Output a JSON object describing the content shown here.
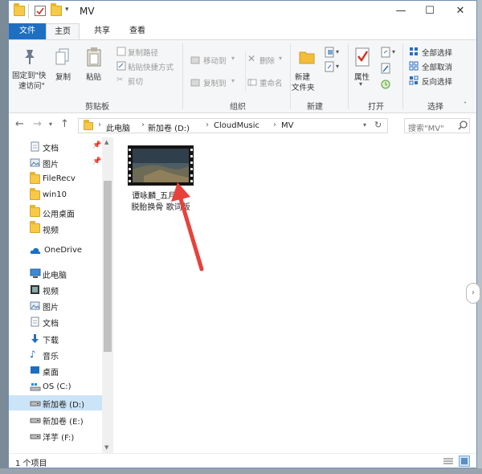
{
  "window": {
    "title": "MV"
  },
  "tabs": {
    "file": "文件",
    "home": "主页",
    "share": "共享",
    "view": "查看"
  },
  "ribbon": {
    "clipboard": {
      "pin_quick": "固定到\"快",
      "pin_quick_2": "速访问\"",
      "copy": "复制",
      "paste": "粘贴",
      "copy_path": "复制路径",
      "paste_shortcut": "粘贴快捷方式",
      "cut": "剪切",
      "group": "剪贴板"
    },
    "organize": {
      "move_to": "移动到",
      "copy_to": "复制到",
      "delete": "删除",
      "rename": "重命名",
      "group": "组织"
    },
    "new": {
      "new_folder": "新建",
      "new_folder_2": "文件夹",
      "group": "新建"
    },
    "open": {
      "properties": "属性",
      "group": "打开"
    },
    "select": {
      "select_all": "全部选择",
      "select_none": "全部取消",
      "invert": "反向选择",
      "group": "选择"
    }
  },
  "address": {
    "crumbs": [
      "此电脑",
      "新加卷 (D:)",
      "CloudMusic",
      "MV"
    ],
    "search_placeholder": "搜索\"MV\""
  },
  "nav": {
    "quick": [
      "文档",
      "图片",
      "FileRecv",
      "win10",
      "公用桌面",
      "视频"
    ],
    "onedrive": "OneDrive",
    "thispc": "此电脑",
    "pc_items": [
      "视频",
      "图片",
      "文档",
      "下载",
      "音乐",
      "桌面",
      "OS (C:)",
      "新加卷 (D:)",
      "新加卷 (E:)",
      "洋芋 (F:)"
    ]
  },
  "content": {
    "file_name_line1": "谭咏麟_五月天 -",
    "file_name_line2": "脱胎换骨 歌词版"
  },
  "status": {
    "count": "1 个项目"
  },
  "colors": {
    "accent": "#1e6fc2",
    "selected": "#cce4f7",
    "arrow": "#e8413c"
  }
}
